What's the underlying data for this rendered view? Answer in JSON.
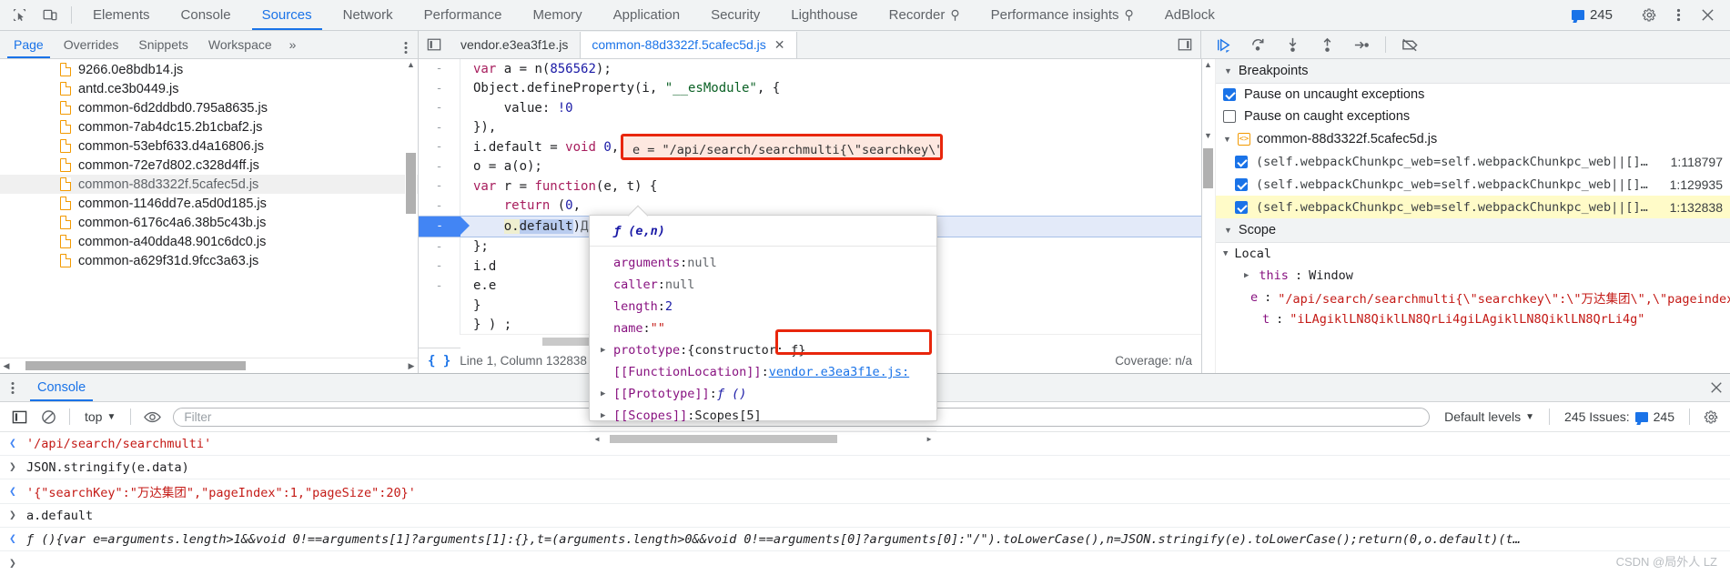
{
  "main_tabs": [
    {
      "label": "Elements",
      "active": false,
      "flask": false
    },
    {
      "label": "Console",
      "active": false,
      "flask": false
    },
    {
      "label": "Sources",
      "active": true,
      "flask": false
    },
    {
      "label": "Network",
      "active": false,
      "flask": false
    },
    {
      "label": "Performance",
      "active": false,
      "flask": false
    },
    {
      "label": "Memory",
      "active": false,
      "flask": false
    },
    {
      "label": "Application",
      "active": false,
      "flask": false
    },
    {
      "label": "Security",
      "active": false,
      "flask": false
    },
    {
      "label": "Lighthouse",
      "active": false,
      "flask": false
    },
    {
      "label": "Recorder",
      "active": false,
      "flask": true
    },
    {
      "label": "Performance insights",
      "active": false,
      "flask": true
    },
    {
      "label": "AdBlock",
      "active": false,
      "flask": false
    }
  ],
  "topbar": {
    "inspect_icon": "inspect-element-icon",
    "device_icon": "device-toolbar-icon",
    "issues_count": "245",
    "settings_icon": "gear-icon",
    "more_icon": "kebab-menu-icon",
    "close_icon": "close-icon",
    "flask_glyph": "⚲"
  },
  "navigator": {
    "tabs": [
      {
        "label": "Page",
        "active": true
      },
      {
        "label": "Overrides",
        "active": false
      },
      {
        "label": "Snippets",
        "active": false
      },
      {
        "label": "Workspace",
        "active": false
      }
    ],
    "more_label": "»",
    "files": [
      {
        "name": "9266.0e8bdb14.js",
        "selected": false
      },
      {
        "name": "antd.ce3b0449.js",
        "selected": false
      },
      {
        "name": "common-6d2ddbd0.795a8635.js",
        "selected": false
      },
      {
        "name": "common-7ab4dc15.2b1cbaf2.js",
        "selected": false
      },
      {
        "name": "common-53ebf633.d4a16806.js",
        "selected": false
      },
      {
        "name": "common-72e7d802.c328d4ff.js",
        "selected": false
      },
      {
        "name": "common-88d3322f.5cafec5d.js",
        "selected": true
      },
      {
        "name": "common-1146dd7e.a5d0d185.js",
        "selected": false
      },
      {
        "name": "common-6176c4a6.38b5c43b.js",
        "selected": false
      },
      {
        "name": "common-a40dda48.901c6dc0.js",
        "selected": false
      },
      {
        "name": "common-a629f31d.9fcc3a63.js",
        "selected": false
      }
    ]
  },
  "editor": {
    "file_tabs": [
      {
        "label": "vendor.e3ea3f1e.js",
        "active": false,
        "closable": false
      },
      {
        "label": "common-88d3322f.5cafec5d.js",
        "active": true,
        "closable": true
      }
    ],
    "code_lines": [
      {
        "gutter": "-",
        "text": "var a = n(856562);",
        "exec": false
      },
      {
        "gutter": "-",
        "text": "Object.defineProperty(i, \"__esModule\", {",
        "exec": false
      },
      {
        "gutter": "-",
        "text": "    value: !0",
        "exec": false
      },
      {
        "gutter": "-",
        "text": "}),",
        "exec": false
      },
      {
        "gutter": "-",
        "text": "i.default = void 0,",
        "exec": false
      },
      {
        "gutter": "-",
        "text": "o = a(o);",
        "exec": false
      },
      {
        "gutter": "-",
        "text": "var r = function(e, t) {",
        "exec": false
      },
      {
        "gutter": "-",
        "text": "    return (0,",
        "exec": false
      },
      {
        "gutter": "-",
        "text": "    o.default)(e, t).toString()",
        "exec": true
      },
      {
        "gutter": "-",
        "text": "};",
        "exec": false
      },
      {
        "gutter": "-",
        "text": "i.d",
        "exec": false
      },
      {
        "gutter": "-",
        "text": "e.e",
        "exec": false
      },
      {
        "gutter": "",
        "text": "}",
        "exec": false
      },
      {
        "gutter": "",
        "text": "} ) ;",
        "exec": false
      }
    ],
    "inline_annotation": "e = \"/api/search/searchmulti{\\\"searchkey\\\":\\\"万达集团\\\"",
    "status_left": "Line 1, Column 132838",
    "status_right": "Coverage: n/a"
  },
  "popover": {
    "title": "ƒ (e,n)",
    "rows": [
      {
        "expand": false,
        "key": "arguments",
        "sep": ": ",
        "value": "null",
        "vclass": "pval-null"
      },
      {
        "expand": false,
        "key": "caller",
        "sep": ": ",
        "value": "null",
        "vclass": "pval-null"
      },
      {
        "expand": false,
        "key": "length",
        "sep": ": ",
        "value": "2",
        "vclass": "pval-num"
      },
      {
        "expand": false,
        "key": "name",
        "sep": ": ",
        "value": "\"\"",
        "vclass": "pval-str"
      },
      {
        "expand": true,
        "key": "prototype",
        "sep": ": ",
        "value": "{constructor: ƒ}",
        "vclass": "pval-plain"
      },
      {
        "expand": false,
        "key": "[[FunctionLocation]]",
        "sep": ": ",
        "value": "vendor.e3ea3f1e.js:",
        "vclass": "plink"
      },
      {
        "expand": true,
        "key": "[[Prototype]]",
        "sep": ": ",
        "value": "ƒ ()",
        "vclass": "pfn"
      },
      {
        "expand": true,
        "key": "[[Scopes]]",
        "sep": ": ",
        "value": "Scopes[5]",
        "vclass": "pval-plain"
      }
    ]
  },
  "debugger": {
    "controls": [
      {
        "name": "resume-script-execution",
        "icon": "resume-icon"
      },
      {
        "name": "step-over-next-function-call",
        "icon": "step-over-icon"
      },
      {
        "name": "step-into-next-function-call",
        "icon": "step-into-icon"
      },
      {
        "name": "step-out-of-current-function",
        "icon": "step-out-icon"
      },
      {
        "name": "step",
        "icon": "step-icon"
      },
      {
        "name": "deactivate-breakpoints",
        "icon": "deactivate-breakpoints-icon"
      }
    ],
    "breakpoints_section": "Breakpoints",
    "pause_uncaught": {
      "label": "Pause on uncaught exceptions",
      "checked": true
    },
    "pause_caught": {
      "label": "Pause on caught exceptions",
      "checked": false
    },
    "bp_file": "common-88d3322f.5cafec5d.js",
    "breakpoints": [
      {
        "checked": true,
        "text": "(self.webpackChunkpc_web=self.webpackChunkpc_web||[]…",
        "loc": "1:118797",
        "highlight": false
      },
      {
        "checked": true,
        "text": "(self.webpackChunkpc_web=self.webpackChunkpc_web||[]…",
        "loc": "1:129935",
        "highlight": false
      },
      {
        "checked": true,
        "text": "(self.webpackChunkpc_web=self.webpackChunkpc_web||[]…",
        "loc": "1:132838",
        "highlight": true
      }
    ],
    "scope_section": "Scope",
    "local_section": "Local",
    "scope_vars": [
      {
        "expand": true,
        "name": "this",
        "sep": ": ",
        "value": "Window",
        "vclass": "vval-obj"
      },
      {
        "expand": false,
        "name": "e",
        "sep": ": ",
        "value": "\"/api/search/searchmulti{\\\"searchkey\\\":\\\"万达集团\\\",\\\"pageindex\\\"",
        "vclass": "vval-str"
      },
      {
        "expand": false,
        "name": "t",
        "sep": ": ",
        "value": "\"iLAgiklLN8QiklLN8QrLi4giLAgiklLN8QiklLN8QrLi4g\"",
        "vclass": "vval-str"
      }
    ]
  },
  "console": {
    "tab_label": "Console",
    "sidebar_icon": "console-sidebar-icon",
    "clear_icon": "clear-console-icon",
    "context": "top",
    "eye_icon": "live-expression-icon",
    "filter_placeholder": "Filter",
    "levels": "Default levels",
    "issues_label": "245 Issues:",
    "issues_count": "245",
    "settings_icon": "gear-icon",
    "entries": [
      {
        "kind": "output",
        "text": "'/api/search/searchmulti'",
        "cls": "c-str"
      },
      {
        "kind": "input",
        "text": "JSON.stringify(e.data)",
        "cls": "c-input"
      },
      {
        "kind": "output",
        "text": "'{\"searchKey\":\"万达集团\",\"pageIndex\":1,\"pageSize\":20}'",
        "cls": "c-str"
      },
      {
        "kind": "input",
        "text": "a.default",
        "cls": "c-input"
      },
      {
        "kind": "output",
        "text": "ƒ (){var e=arguments.length>1&&void 0!==arguments[1]?arguments[1]:{},t=(arguments.length>0&&void 0!==arguments[0]?arguments[0]:\"/\").toLowerCase(),n=JSON.stringify(e).toLowerCase();return(0,o.default)(t…",
        "cls": "c-fn"
      }
    ],
    "prompt": ">"
  },
  "watermark": "CSDN @局外人 LZ"
}
